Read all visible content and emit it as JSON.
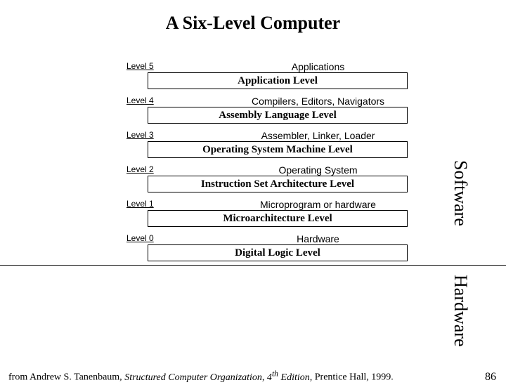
{
  "title": "A Six-Level Computer",
  "levels": [
    {
      "num": "Level 5",
      "desc": "Applications",
      "name": "Application Level"
    },
    {
      "num": "Level 4",
      "desc": "Compilers, Editors, Navigators",
      "name": "Assembly Language Level"
    },
    {
      "num": "Level 3",
      "desc": "Assembler, Linker, Loader",
      "name": "Operating System Machine Level"
    },
    {
      "num": "Level 2",
      "desc": "Operating System",
      "name": "Instruction Set Architecture Level"
    },
    {
      "num": "Level 1",
      "desc": "Microprogram or hardware",
      "name": "Microarchitecture Level"
    },
    {
      "num": "Level 0",
      "desc": "Hardware",
      "name": "Digital Logic Level"
    }
  ],
  "side_labels": {
    "software": "Software",
    "hardware": "Hardware"
  },
  "footer": {
    "prefix": "from Andrew S. Tanenbaum, ",
    "title_italic": "Structured Computer Organization, 4",
    "sup": "th",
    "title_italic2": " Edition, ",
    "suffix": "Prentice Hall, 1999."
  },
  "page_number": "86"
}
